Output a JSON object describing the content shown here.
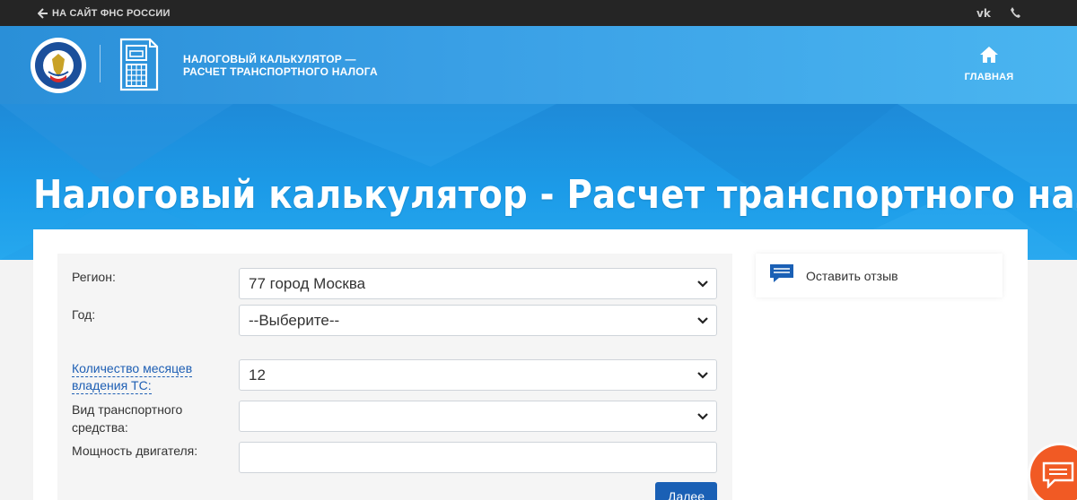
{
  "topbar": {
    "back_link": "НА САЙТ ФНС РОССИИ",
    "vk_icon": "vk-icon",
    "phone_icon": "phone-icon"
  },
  "header": {
    "app_name_line1": "НАЛОГОВЫЙ КАЛЬКУЛЯТОР —",
    "app_name_line2": "РАСЧЕТ ТРАНСПОРТНОГО НАЛОГА",
    "home_label": "ГЛАВНАЯ",
    "home_icon": "home-icon"
  },
  "hero": {
    "title": "Налоговый калькулятор - Расчет транспортного налога"
  },
  "form": {
    "region": {
      "label": "Регион:",
      "value": "77 город Москва"
    },
    "year": {
      "label": "Год:",
      "value": "--Выберите--"
    },
    "months": {
      "label_line1": "Количество месяцев",
      "label_line2": "владения ТС:",
      "value": "12"
    },
    "vehicle_type": {
      "label_line1": "Вид транспортного",
      "label_line2": "средства:",
      "value": ""
    },
    "engine_power": {
      "label": "Мощность двигателя:",
      "value": ""
    },
    "next_button": "Далее"
  },
  "sidebar": {
    "feedback_label": "Оставить отзыв",
    "feedback_icon": "feedback-icon"
  },
  "colors": {
    "topbar": "#252525",
    "header_blue": "#3aa0e6",
    "primary_button": "#1a60b5",
    "link": "#1e5fb4",
    "chat_fab": "#f15a24"
  }
}
